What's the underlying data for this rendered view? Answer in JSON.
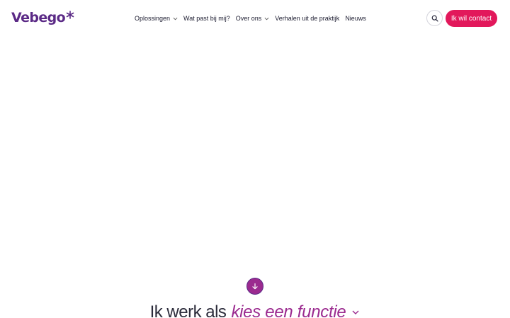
{
  "brand": {
    "name": "Vebego",
    "colors": {
      "primary": "#5b2a86",
      "accent": "#e2185b",
      "magenta": "#9b2a8f"
    }
  },
  "nav": {
    "items": [
      {
        "label": "Oplossingen",
        "has_dropdown": true
      },
      {
        "label": "Wat past bij mij?",
        "has_dropdown": false
      },
      {
        "label": "Over ons",
        "has_dropdown": true
      },
      {
        "label": "Verhalen uit de praktijk",
        "has_dropdown": false
      },
      {
        "label": "Nieuws",
        "has_dropdown": false
      }
    ]
  },
  "header": {
    "search_icon": "search-icon",
    "contact_label": "Ik wil contact"
  },
  "hero": {
    "scroll_icon": "arrow-down-icon",
    "headline_static": "Ik werk als",
    "headline_select": "kies een functie"
  }
}
